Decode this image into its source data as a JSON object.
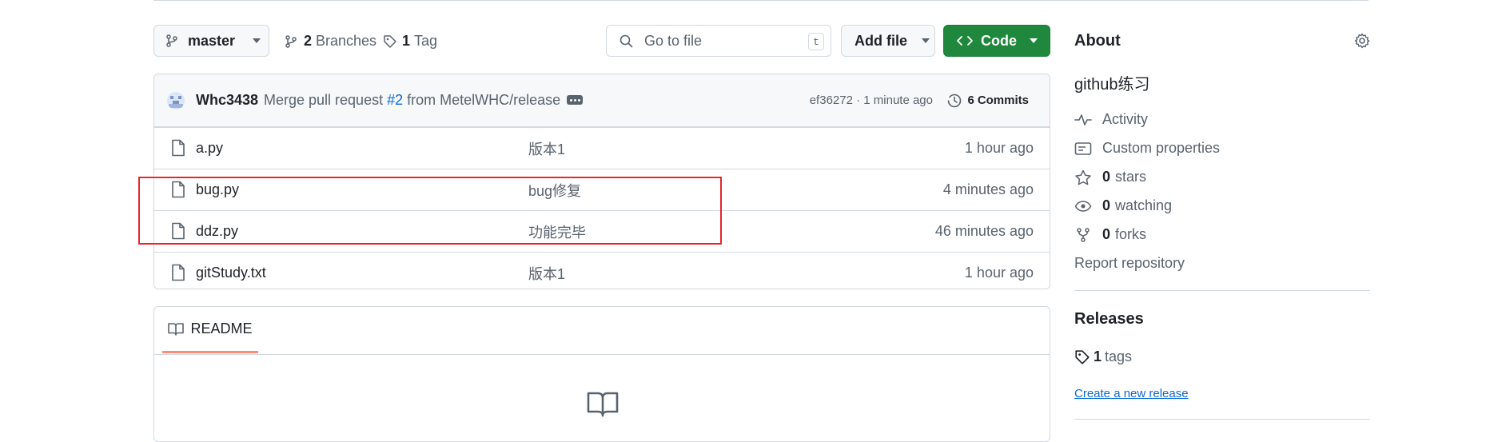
{
  "toolbar": {
    "branch": "master",
    "branches_count": "2",
    "branches_label": "Branches",
    "tags_count": "1",
    "tags_label": "Tag",
    "search_placeholder": "Go to file",
    "search_shortcut": "t",
    "add_file_label": "Add file",
    "code_label": "Code"
  },
  "commit": {
    "author": "Whc3438",
    "message_prefix": "Merge pull request",
    "pr_link": "#2",
    "message_suffix": "from MetelWHC/release",
    "hash_time": "ef36272 · 1 minute ago",
    "commits_count": "6",
    "commits_label": "Commits"
  },
  "files": [
    {
      "name": "a.py",
      "message": "版本1",
      "time": "1 hour ago"
    },
    {
      "name": "bug.py",
      "message": "bug修复",
      "time": "4 minutes ago"
    },
    {
      "name": "ddz.py",
      "message": "功能完毕",
      "time": "46 minutes ago"
    },
    {
      "name": "gitStudy.txt",
      "message": "版本1",
      "time": "1 hour ago"
    }
  ],
  "readme": {
    "tab_label": "README"
  },
  "about": {
    "title": "About",
    "description": "github练习",
    "activity": "Activity",
    "custom_properties": "Custom properties",
    "stars_count": "0",
    "stars_label": "stars",
    "watching_count": "0",
    "watching_label": "watching",
    "forks_count": "0",
    "forks_label": "forks",
    "report": "Report repository"
  },
  "releases": {
    "title": "Releases",
    "tags_count": "1",
    "tags_label": "tags",
    "create_link": "Create a new release"
  },
  "colors": {
    "code_button": "#1f883d",
    "link": "#0969da",
    "highlight_box": "#e5262c",
    "tab_underline": "#fd8c73"
  }
}
